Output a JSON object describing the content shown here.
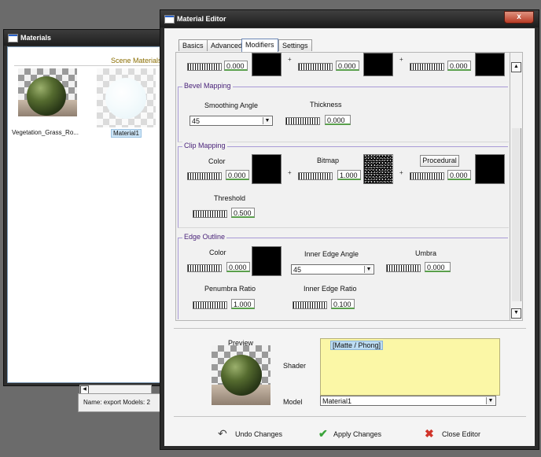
{
  "materials_window": {
    "title": "Materials",
    "section_label": "Scene Materials",
    "items": [
      {
        "label": "Vegetation_Grass_Ro...",
        "selected": false
      },
      {
        "label": "Material1",
        "selected": true
      }
    ],
    "status": "Name: export Models: 2"
  },
  "editor": {
    "title": "Material Editor",
    "close_glyph": "x",
    "tabs": [
      {
        "label": "Basics",
        "active": false
      },
      {
        "label": "Advanced",
        "active": false
      },
      {
        "label": "Modifiers",
        "active": true
      },
      {
        "label": "Settings",
        "active": false
      }
    ],
    "top_row": {
      "values": [
        "0.000",
        "0.000",
        "0.000"
      ],
      "plus": "+"
    },
    "bevel": {
      "title": "Bevel Mapping",
      "smoothing_label": "Smoothing Angle",
      "smoothing_value": "45",
      "thickness_label": "Thickness",
      "thickness_value": "0.000"
    },
    "clip": {
      "title": "Clip Mapping",
      "color_label": "Color",
      "color_value": "0.000",
      "bitmap_label": "Bitmap",
      "bitmap_value": "1.000",
      "procedural_label": "Procedural",
      "procedural_value": "0.000",
      "threshold_label": "Threshold",
      "threshold_value": "0.500"
    },
    "edge": {
      "title": "Edge Outline",
      "color_label": "Color",
      "color_value": "0.000",
      "inner_angle_label": "Inner Edge Angle",
      "inner_angle_value": "45",
      "umbra_label": "Umbra",
      "umbra_value": "0.000",
      "penumbra_label": "Penumbra Ratio",
      "penumbra_value": "1.000",
      "inner_ratio_label": "Inner Edge Ratio",
      "inner_ratio_value": "0.100"
    },
    "preview": {
      "label": "Preview",
      "shader_label": "Shader",
      "shader_item": "[Matte / Phong]",
      "model_label": "Model",
      "model_value": "Material1"
    },
    "actions": {
      "undo": "Undo Changes",
      "apply": "Apply Changes",
      "close": "Close Editor"
    }
  },
  "colors": {
    "group_title": "#4a237a",
    "group_line": "#a89ad6",
    "shader_bg": "#fbf7a6",
    "apply_icon": "#3aa43a",
    "close_icon": "#d0342a"
  },
  "icons": [
    "window-icon",
    "close-icon",
    "undo-icon",
    "apply-checkmark-icon",
    "close-editor-x-icon",
    "chevron-down-icon"
  ]
}
